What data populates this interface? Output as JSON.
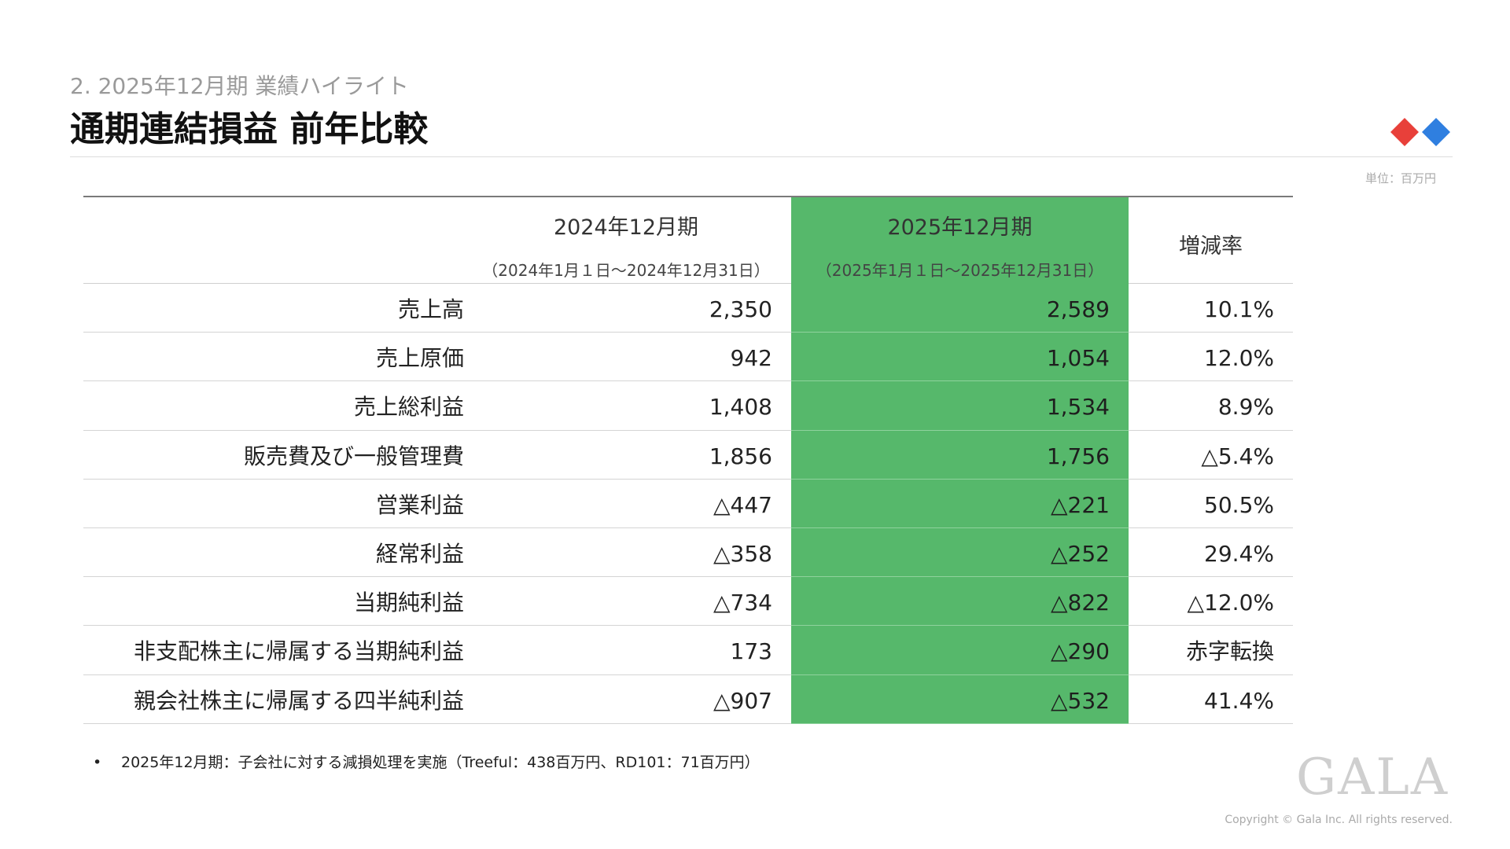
{
  "header": {
    "section": "2. 2025年12月期  業績ハイライト",
    "title": "通期連結損益 前年比較",
    "unit": "単位：百万円"
  },
  "table": {
    "columns": [
      {
        "name": "2024年12月期",
        "range": "（2024年1月１日～2024年12月31日）"
      },
      {
        "name": "2025年12月期",
        "range": "（2025年1月１日～2025年12月31日）"
      },
      {
        "name": "増減率"
      }
    ],
    "rows": [
      {
        "label": "売上高",
        "fy2024": "2,350",
        "fy2025": "2,589",
        "change": "10.1%"
      },
      {
        "label": "売上原価",
        "fy2024": "942",
        "fy2025": "1,054",
        "change": "12.0%"
      },
      {
        "label": "売上総利益",
        "fy2024": "1,408",
        "fy2025": "1,534",
        "change": "8.9%"
      },
      {
        "label": "販売費及び一般管理費",
        "fy2024": "1,856",
        "fy2025": "1,756",
        "change": "△5.4%"
      },
      {
        "label": "営業利益",
        "fy2024": "△447",
        "fy2025": "△221",
        "change": "50.5%"
      },
      {
        "label": "経常利益",
        "fy2024": "△358",
        "fy2025": "△252",
        "change": "29.4%"
      },
      {
        "label": "当期純利益",
        "fy2024": "△734",
        "fy2025": "△822",
        "change": "△12.0%"
      },
      {
        "label": "非支配株主に帰属する当期純利益",
        "fy2024": "173",
        "fy2025": "△290",
        "change": "赤字転換"
      },
      {
        "label": "親会社株主に帰属する四半純利益",
        "fy2024": "△907",
        "fy2025": "△532",
        "change": "41.4%"
      }
    ]
  },
  "footnote": {
    "bullet": "•",
    "text": "2025年12月期：子会社に対する減損処理を実施（Treeful：438百万円、RD101：71百万円）"
  },
  "footer": {
    "logo_text": "GALA",
    "copyright": "Copyright © Gala Inc. All rights reserved."
  },
  "colors": {
    "highlight_column": "#56b86b",
    "diamond_red": "#e8403a",
    "diamond_blue": "#2f7fe0"
  }
}
